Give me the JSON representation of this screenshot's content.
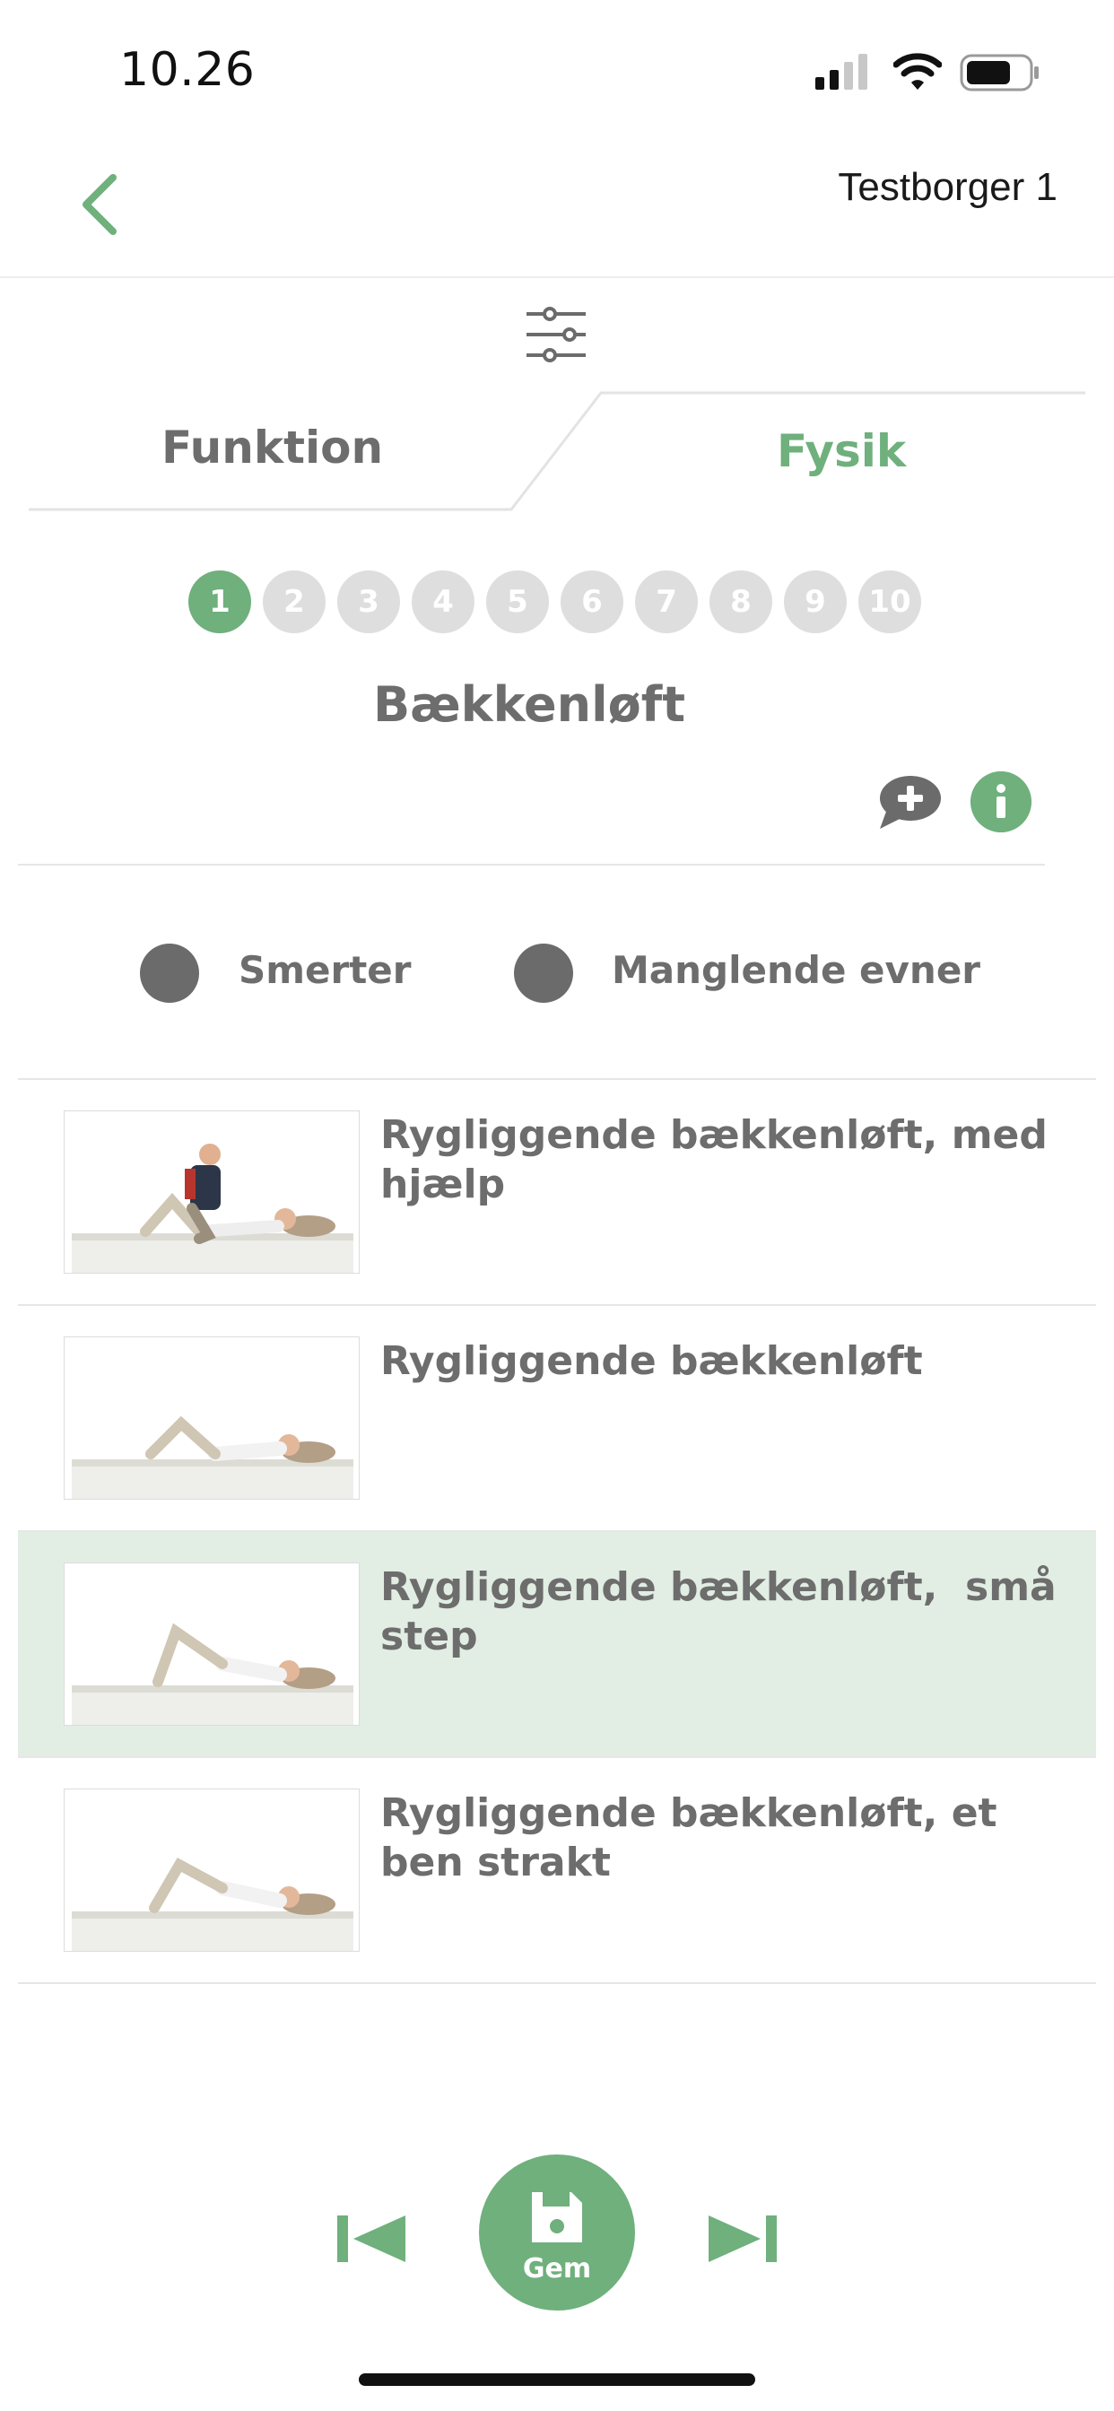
{
  "status_bar": {
    "time": "10.26"
  },
  "nav": {
    "title": "Testborger 1"
  },
  "tabs": [
    {
      "label": "Funktion",
      "active": false
    },
    {
      "label": "Fysik",
      "active": true
    }
  ],
  "pagination": {
    "pages": [
      "1",
      "2",
      "3",
      "4",
      "5",
      "6",
      "7",
      "8",
      "9",
      "10"
    ],
    "current": "1"
  },
  "exercise": {
    "title": "Bækkenløft"
  },
  "legend": [
    {
      "label": "Smerter",
      "color": "#6b6b6b"
    },
    {
      "label": "Manglende evner",
      "color": "#6b6b6b"
    }
  ],
  "options": [
    {
      "label": "Rygliggende bækkenløft, med hjælp",
      "selected": false
    },
    {
      "label": "Rygliggende bækkenløft",
      "selected": false
    },
    {
      "label": "Rygliggende bækkenløft,  små step",
      "selected": true
    },
    {
      "label": "Rygliggende bækkenløft, et ben strakt",
      "selected": false
    }
  ],
  "footer": {
    "save_label": "Gem"
  },
  "colors": {
    "accent": "#6fb07d",
    "selected_row": "#e2eee4",
    "text": "#6d6d6d"
  },
  "icons": [
    "back-chevron-icon",
    "filter-sliders-icon",
    "comment-add-icon",
    "info-icon",
    "skip-previous-icon",
    "save-icon",
    "skip-next-icon"
  ]
}
